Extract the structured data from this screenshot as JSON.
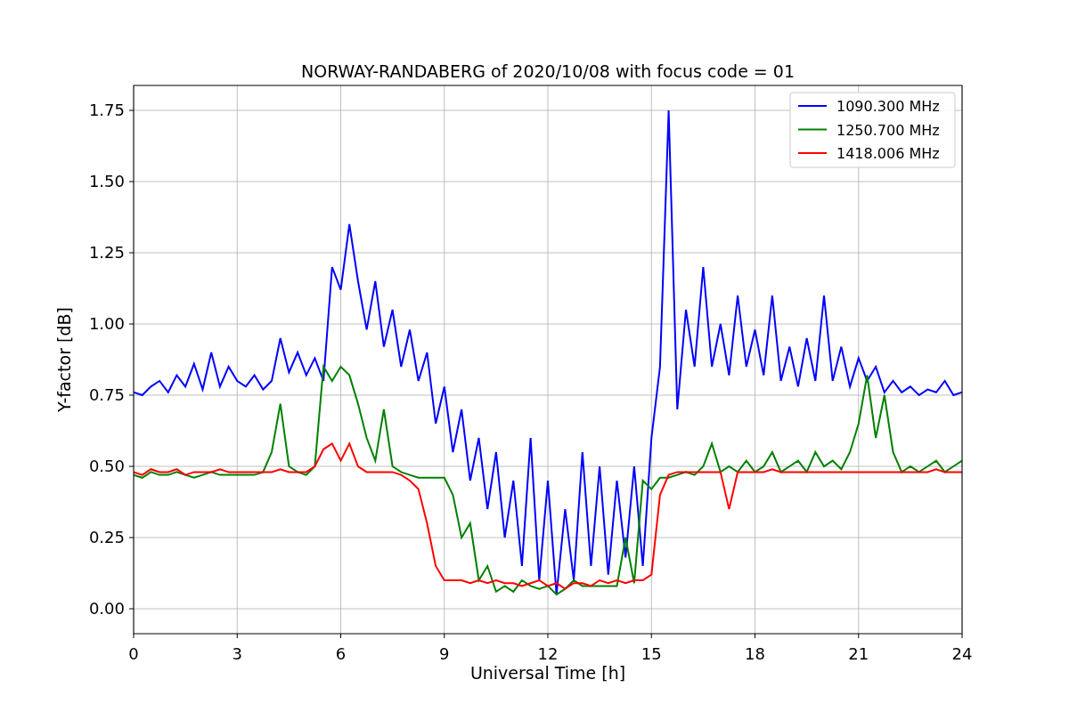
{
  "chart_data": {
    "type": "line",
    "title": "NORWAY-RANDABERG of 2020/10/08 with focus code = 01",
    "xlabel": "Universal Time [h]",
    "ylabel": "Y-factor [dB]",
    "grid": true,
    "legend": true,
    "xlim": [
      0,
      24
    ],
    "ylim": [
      -0.0875,
      1.8375
    ],
    "xticks": [
      0,
      3,
      6,
      9,
      12,
      15,
      18,
      21,
      24
    ],
    "yticks": [
      {
        "value": 0,
        "label": "0.00"
      },
      {
        "value": 0.25,
        "label": "0.25"
      },
      {
        "value": 0.5,
        "label": "0.50"
      },
      {
        "value": 0.75,
        "label": "0.75"
      },
      {
        "value": 1,
        "label": "1.00"
      },
      {
        "value": 1.25,
        "label": "1.25"
      },
      {
        "value": 1.5,
        "label": "1.50"
      },
      {
        "value": 1.75,
        "label": "1.75"
      }
    ],
    "x": [
      0,
      0.25,
      0.5,
      0.75,
      1,
      1.25,
      1.5,
      1.75,
      2,
      2.25,
      2.5,
      2.75,
      3,
      3.25,
      3.5,
      3.75,
      4,
      4.25,
      4.5,
      4.75,
      5,
      5.25,
      5.5,
      5.75,
      6,
      6.25,
      6.5,
      6.75,
      7,
      7.25,
      7.5,
      7.75,
      8,
      8.25,
      8.5,
      8.75,
      9,
      9.25,
      9.5,
      9.75,
      10,
      10.25,
      10.5,
      10.75,
      11,
      11.25,
      11.5,
      11.75,
      12,
      12.25,
      12.5,
      12.75,
      13,
      13.25,
      13.5,
      13.75,
      14,
      14.25,
      14.5,
      14.75,
      15,
      15.25,
      15.5,
      15.75,
      16,
      16.25,
      16.5,
      16.75,
      17,
      17.25,
      17.5,
      17.75,
      18,
      18.25,
      18.5,
      18.75,
      19,
      19.25,
      19.5,
      19.75,
      20,
      20.25,
      20.5,
      20.75,
      21,
      21.25,
      21.5,
      21.75,
      22,
      22.25,
      22.5,
      22.75,
      23,
      23.25,
      23.5,
      23.75,
      24
    ],
    "series": [
      {
        "name": "1090.300 MHz",
        "color": "#0000ff",
        "values": [
          0.76,
          0.75,
          0.78,
          0.8,
          0.76,
          0.82,
          0.78,
          0.86,
          0.77,
          0.9,
          0.78,
          0.85,
          0.8,
          0.78,
          0.82,
          0.77,
          0.8,
          0.95,
          0.83,
          0.9,
          0.82,
          0.88,
          0.8,
          1.2,
          1.12,
          1.35,
          1.15,
          0.98,
          1.15,
          0.92,
          1.05,
          0.85,
          0.98,
          0.8,
          0.9,
          0.65,
          0.78,
          0.55,
          0.7,
          0.45,
          0.6,
          0.35,
          0.55,
          0.25,
          0.45,
          0.15,
          0.6,
          0.1,
          0.45,
          0.05,
          0.35,
          0.1,
          0.55,
          0.15,
          0.5,
          0.12,
          0.45,
          0.18,
          0.5,
          0.15,
          0.6,
          0.85,
          1.75,
          0.7,
          1.05,
          0.85,
          1.2,
          0.85,
          1.0,
          0.82,
          1.1,
          0.85,
          0.98,
          0.82,
          1.1,
          0.8,
          0.92,
          0.78,
          0.95,
          0.8,
          1.1,
          0.8,
          0.92,
          0.78,
          0.88,
          0.8,
          0.85,
          0.76,
          0.8,
          0.76,
          0.78,
          0.75,
          0.77,
          0.76,
          0.8,
          0.75,
          0.76
        ]
      },
      {
        "name": "1250.700 MHz",
        "color": "#008000",
        "values": [
          0.47,
          0.46,
          0.48,
          0.47,
          0.47,
          0.48,
          0.47,
          0.46,
          0.47,
          0.48,
          0.47,
          0.47,
          0.47,
          0.47,
          0.47,
          0.48,
          0.55,
          0.72,
          0.5,
          0.48,
          0.47,
          0.5,
          0.85,
          0.8,
          0.85,
          0.82,
          0.72,
          0.6,
          0.52,
          0.7,
          0.5,
          0.48,
          0.47,
          0.46,
          0.46,
          0.46,
          0.46,
          0.4,
          0.25,
          0.3,
          0.1,
          0.15,
          0.06,
          0.08,
          0.06,
          0.1,
          0.08,
          0.07,
          0.08,
          0.05,
          0.07,
          0.1,
          0.08,
          0.08,
          0.08,
          0.08,
          0.08,
          0.25,
          0.09,
          0.45,
          0.42,
          0.46,
          0.46,
          0.47,
          0.48,
          0.47,
          0.5,
          0.58,
          0.48,
          0.5,
          0.48,
          0.52,
          0.48,
          0.5,
          0.55,
          0.48,
          0.5,
          0.52,
          0.48,
          0.55,
          0.5,
          0.52,
          0.49,
          0.55,
          0.65,
          0.82,
          0.6,
          0.75,
          0.55,
          0.48,
          0.5,
          0.48,
          0.5,
          0.52,
          0.48,
          0.5,
          0.52
        ]
      },
      {
        "name": "1418.006 MHz",
        "color": "#ff0000",
        "values": [
          0.48,
          0.47,
          0.49,
          0.48,
          0.48,
          0.49,
          0.47,
          0.48,
          0.48,
          0.48,
          0.49,
          0.48,
          0.48,
          0.48,
          0.48,
          0.48,
          0.48,
          0.49,
          0.48,
          0.48,
          0.48,
          0.5,
          0.56,
          0.58,
          0.52,
          0.58,
          0.5,
          0.48,
          0.48,
          0.48,
          0.48,
          0.47,
          0.45,
          0.42,
          0.3,
          0.15,
          0.1,
          0.1,
          0.1,
          0.09,
          0.1,
          0.09,
          0.1,
          0.09,
          0.09,
          0.08,
          0.09,
          0.1,
          0.08,
          0.09,
          0.07,
          0.09,
          0.09,
          0.08,
          0.1,
          0.09,
          0.1,
          0.09,
          0.1,
          0.1,
          0.12,
          0.4,
          0.47,
          0.48,
          0.48,
          0.48,
          0.48,
          0.48,
          0.48,
          0.35,
          0.48,
          0.48,
          0.48,
          0.48,
          0.49,
          0.48,
          0.48,
          0.48,
          0.48,
          0.48,
          0.48,
          0.48,
          0.48,
          0.48,
          0.48,
          0.48,
          0.48,
          0.48,
          0.48,
          0.48,
          0.48,
          0.48,
          0.48,
          0.49,
          0.48,
          0.48,
          0.48
        ]
      }
    ]
  }
}
